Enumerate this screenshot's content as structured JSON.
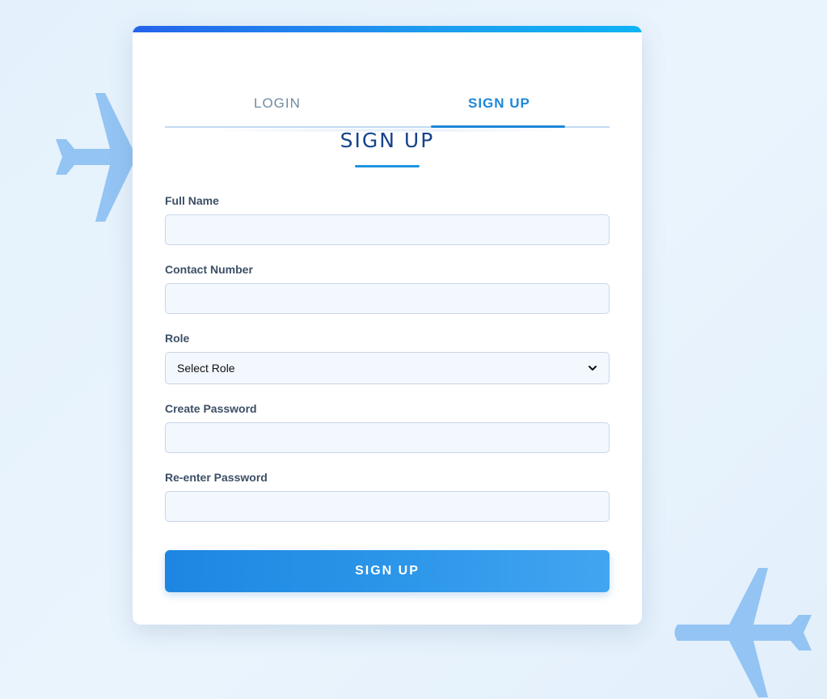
{
  "background": {
    "plane_color": "#93c4f3",
    "icons": [
      "airplane-icon",
      "airplane-icon"
    ]
  },
  "tabs": [
    {
      "label": "LOGIN",
      "active": false
    },
    {
      "label": "SIGN UP",
      "active": true
    }
  ],
  "form": {
    "title": "SIGN UP",
    "fields": {
      "full_name": {
        "label": "Full Name",
        "value": ""
      },
      "contact_number": {
        "label": "Contact Number",
        "value": ""
      },
      "role": {
        "label": "Role",
        "selected": "Select Role"
      },
      "create_password": {
        "label": "Create Password",
        "value": ""
      },
      "reenter_password": {
        "label": "Re-enter Password",
        "value": ""
      }
    },
    "submit_label": "SIGN UP"
  },
  "colors": {
    "accent": "#1e88d8",
    "title": "#15438a",
    "button_start": "#1e86e2",
    "button_end": "#42a5f2",
    "top_bar_start": "#2563eb",
    "top_bar_end": "#0db3f5"
  }
}
